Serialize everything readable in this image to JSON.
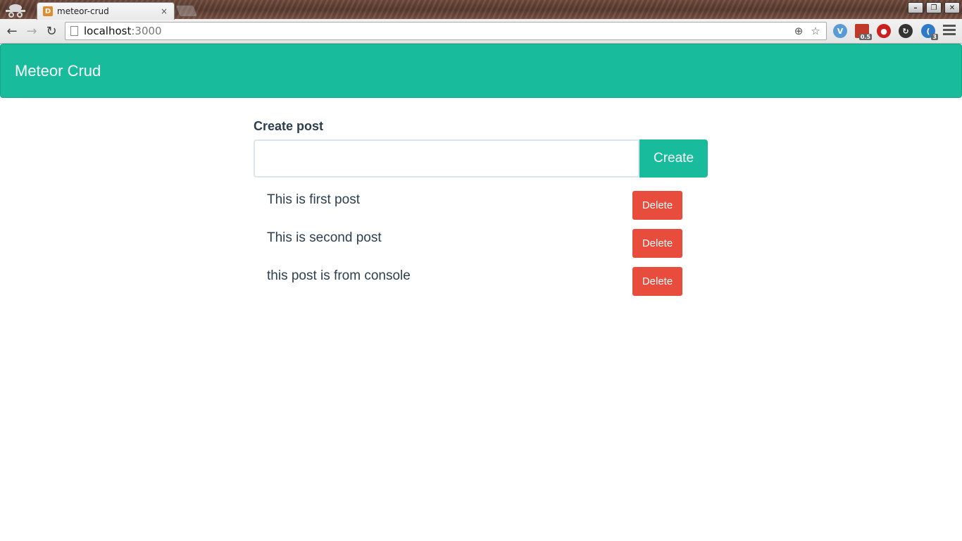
{
  "browser": {
    "tab_title": "meteor-crud",
    "tab_close": "×",
    "url_host": "localhost",
    "url_port": ":3000",
    "extensions": [
      {
        "name": "v-extension-icon",
        "color": "#5b9bd5",
        "glyph": "V"
      },
      {
        "name": "color-grid-extension-icon",
        "color": "#c0392b",
        "glyph": "",
        "badge": "0.5"
      },
      {
        "name": "adblock-icon",
        "color": "#cc1f1f",
        "glyph": "●"
      },
      {
        "name": "sync-icon",
        "color": "#333333",
        "glyph": "↻"
      },
      {
        "name": "wave-extension-icon",
        "color": "#2f79c9",
        "glyph": "(",
        "badge": "3"
      }
    ]
  },
  "app": {
    "brand": "Meteor Crud",
    "create_label": "Create post",
    "input_value": "",
    "create_button": "Create",
    "posts": [
      {
        "text": "This is first post",
        "delete_label": "Delete"
      },
      {
        "text": "This is second post",
        "delete_label": "Delete"
      },
      {
        "text": "this post is from console",
        "delete_label": "Delete"
      }
    ]
  },
  "colors": {
    "navbar": "#18bc9c",
    "delete": "#e74c3c",
    "text": "#2c3e50"
  }
}
